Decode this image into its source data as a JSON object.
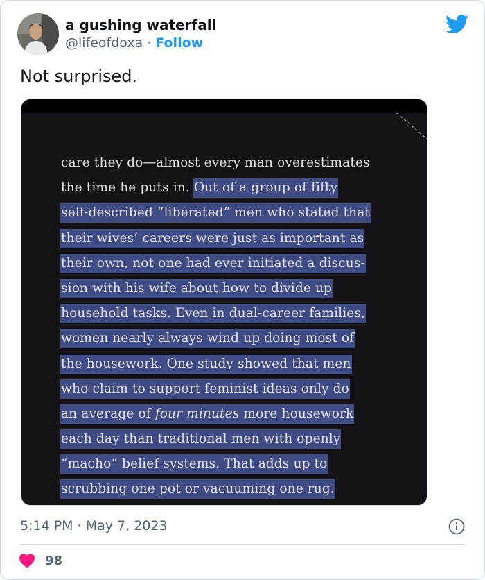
{
  "author": {
    "name": "a gushing waterfall",
    "handle": "@lifeofdoxa",
    "separator": "·",
    "follow_label": "Follow"
  },
  "tweet": {
    "text": "Not surprised."
  },
  "media": {
    "book_lines": [
      {
        "segments": [
          {
            "text": "care they do—almost every man overestimates",
            "highlight": false
          }
        ]
      },
      {
        "segments": [
          {
            "text": "the time he puts in. ",
            "highlight": false
          },
          {
            "text": "Out of a group of fifty",
            "highlight": true
          }
        ]
      },
      {
        "segments": [
          {
            "text": "self-described “liberated” men who stated that",
            "highlight": true
          }
        ]
      },
      {
        "segments": [
          {
            "text": "their wives’ careers were just as important as",
            "highlight": true
          }
        ]
      },
      {
        "segments": [
          {
            "text": "their own, not one had ever initiated a discus-",
            "highlight": true
          }
        ]
      },
      {
        "segments": [
          {
            "text": "sion with his wife about how to divide up",
            "highlight": true
          }
        ]
      },
      {
        "segments": [
          {
            "text": "household tasks. Even in dual-career families,",
            "highlight": true
          }
        ]
      },
      {
        "segments": [
          {
            "text": "women nearly always wind up doing most of",
            "highlight": true
          }
        ]
      },
      {
        "segments": [
          {
            "text": "the housework. One study showed that men",
            "highlight": true
          }
        ]
      },
      {
        "segments": [
          {
            "text": "who claim to support feminist ideas only do",
            "highlight": true
          }
        ]
      },
      {
        "segments": [
          {
            "text": "an average of ",
            "highlight": true
          },
          {
            "text": "four minutes",
            "highlight": true,
            "italic": true
          },
          {
            "text": " more housework",
            "highlight": true
          }
        ]
      },
      {
        "segments": [
          {
            "text": "each day than traditional men with openly",
            "highlight": true
          }
        ]
      },
      {
        "segments": [
          {
            "text": "“macho” belief systems. That adds up to",
            "highlight": true
          }
        ]
      },
      {
        "segments": [
          {
            "text": "scrubbing one pot or vacuuming one rug.",
            "highlight": true
          }
        ]
      }
    ]
  },
  "footer": {
    "time": "5:14 PM",
    "separator": "·",
    "date": "May 7, 2023",
    "likes": "98"
  },
  "colors": {
    "twitter_blue": "#1d9bf0",
    "heart_red": "#f91880",
    "highlight": "#3e4b84",
    "book_bg": "#151217"
  },
  "icons": {
    "logo": "twitter-bird-icon",
    "info": "info-icon",
    "like": "heart-icon"
  }
}
